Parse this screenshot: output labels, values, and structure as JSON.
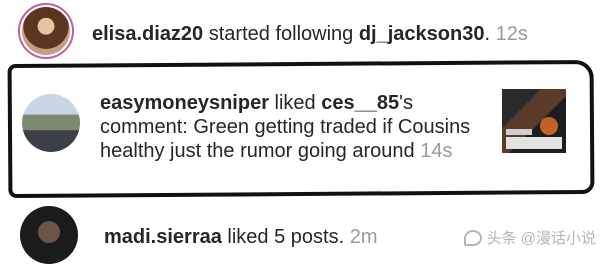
{
  "notifications": [
    {
      "user": "elisa.diaz20",
      "action": "started following",
      "target": "dj_jackson30",
      "punct": ".",
      "time": "12s"
    },
    {
      "user": "easymoneysniper",
      "action": "liked",
      "target": "ces__85",
      "possessive": "'s",
      "text": "comment: Green getting traded if Cousins healthy just the rumor going around",
      "time": "14s"
    },
    {
      "user": "madi.sierraa",
      "action": "liked 5 posts.",
      "time": "2m"
    }
  ],
  "watermark": {
    "text": "头条 @漫话小说"
  }
}
